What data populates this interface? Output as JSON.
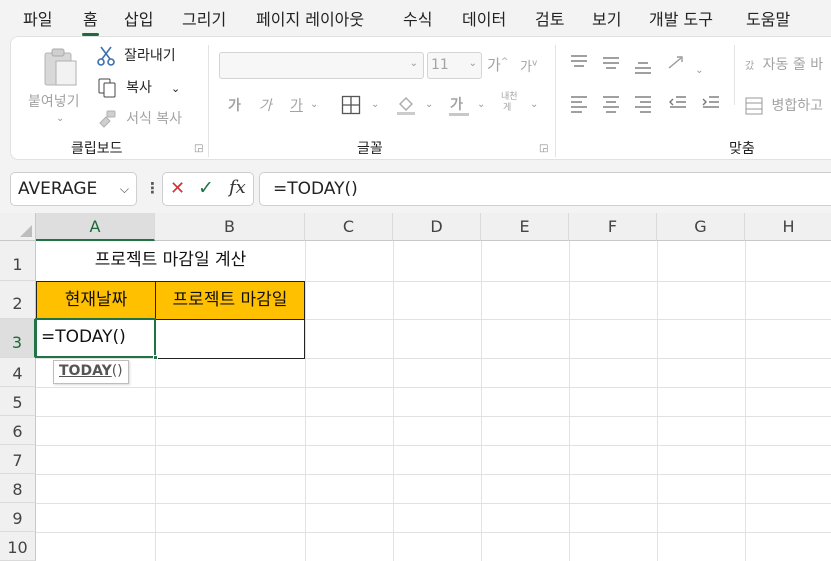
{
  "menu_tabs": [
    "파일",
    "홈",
    "삽입",
    "그리기",
    "페이지 레이아웃",
    "수식",
    "데이터",
    "검토",
    "보기",
    "개발 도구",
    "도움말"
  ],
  "ribbon": {
    "clipboard": {
      "paste": "붙여넣기",
      "cut": "잘라내기",
      "copy": "복사",
      "format_painter": "서식 복사",
      "label": "클립보드"
    },
    "font": {
      "font_name": "",
      "font_size": "11",
      "increase": "가",
      "decrease": "가",
      "bold": "가",
      "italic": "가",
      "underline": "가",
      "font_color": "가",
      "phonetic_top": "내천",
      "phonetic_bottom": "게",
      "label": "글꼴"
    },
    "alignment": {
      "wrap_prefix": "갔",
      "wrap": "자동 줄 바",
      "merge": "병합하고",
      "label": "맞춤"
    }
  },
  "formula_bar": {
    "name_box": "AVERAGE",
    "cancel_glyph": "✕",
    "enter_glyph": "✓",
    "fx": "fx",
    "formula": "=TODAY()"
  },
  "sheet": {
    "columns": [
      "A",
      "B",
      "C",
      "D",
      "E",
      "F",
      "G",
      "H"
    ],
    "rows": [
      "1",
      "2",
      "3",
      "4",
      "5",
      "6",
      "7",
      "8",
      "9",
      "10"
    ],
    "title": "프로젝트 마감일 계산",
    "header_a": "현재날짜",
    "header_b": "프로젝트 마감일",
    "a3_editing": "=TODAY()",
    "tooltip_fn": "TODAY",
    "tooltip_paren": "()"
  },
  "colors": {
    "header_fill": "#ffc000",
    "accent_green": "#217346",
    "cancel_red": "#d13438"
  },
  "icons": [
    "paste-icon",
    "scissors-icon",
    "copy-icon",
    "format-painter-icon",
    "border-icon",
    "fill-color-icon",
    "wrap-text-icon",
    "merge-icon"
  ]
}
